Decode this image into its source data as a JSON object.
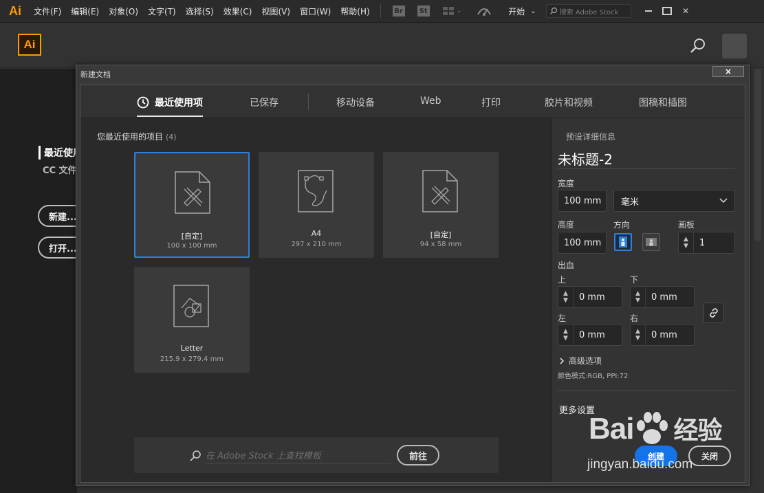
{
  "menubar": {
    "logo": "Ai",
    "items": [
      "文件(F)",
      "编辑(E)",
      "对象(O)",
      "文字(T)",
      "选择(S)",
      "效果(C)",
      "视图(V)",
      "窗口(W)",
      "帮助(H)"
    ],
    "btn_bridge": "Br",
    "btn_stock": "St",
    "workspace": "开始",
    "search_placeholder": "搜索 Adobe Stock"
  },
  "header": {
    "logo": "Ai"
  },
  "left_panel": {
    "recent": "最近使用",
    "cc_files": "CC 文件",
    "new_button": "新建...",
    "open_button": "打开..."
  },
  "dialog": {
    "title": "新建文档",
    "close": "×",
    "tabs": [
      "最近使用项",
      "已保存",
      "移动设备",
      "Web",
      "打印",
      "胶片和视频",
      "图稿和插图"
    ],
    "recent_label": "您最近使用的项目",
    "recent_count": "(4)",
    "presets": [
      {
        "name": "[自定]",
        "size": "100 x 100 mm",
        "selected": true,
        "icon": "custom-document-icon"
      },
      {
        "name": "A4",
        "size": "297 x 210 mm",
        "selected": false,
        "icon": "a4-document-icon"
      },
      {
        "name": "[自定]",
        "size": "94 x 58 mm",
        "selected": false,
        "icon": "custom-document-icon"
      },
      {
        "name": "Letter",
        "size": "215.9 x 279.4 mm",
        "selected": false,
        "icon": "letter-document-icon"
      }
    ],
    "stock_search_placeholder": "在 Adobe Stock 上查找模板",
    "go_button": "前往",
    "details": {
      "header": "预设详细信息",
      "doc_name": "未标题-2",
      "width_label": "宽度",
      "width_value": "100 mm",
      "unit": "毫米",
      "height_label": "高度",
      "height_value": "100 mm",
      "orientation_label": "方向",
      "artboards_label": "画板",
      "artboards_value": "1",
      "bleed_label": "出血",
      "top_label": "上",
      "top_value": "0 mm",
      "bottom_label": "下",
      "bottom_value": "0 mm",
      "left_label": "左",
      "left_value": "0 mm",
      "right_label": "右",
      "right_value": "0 mm",
      "advanced": "高级选项",
      "color_info": "颜色模式:RGB, PPI:72",
      "more_settings": "更多设置",
      "create_button": "创建",
      "close_button": "关闭"
    }
  },
  "watermark": {
    "text": "Bai",
    "text2": "经验",
    "url": "jingyan.baidu.com"
  },
  "colors": {
    "accent": "#2d7fe0",
    "brand": "#ff9a00",
    "create": "#1473e6"
  }
}
